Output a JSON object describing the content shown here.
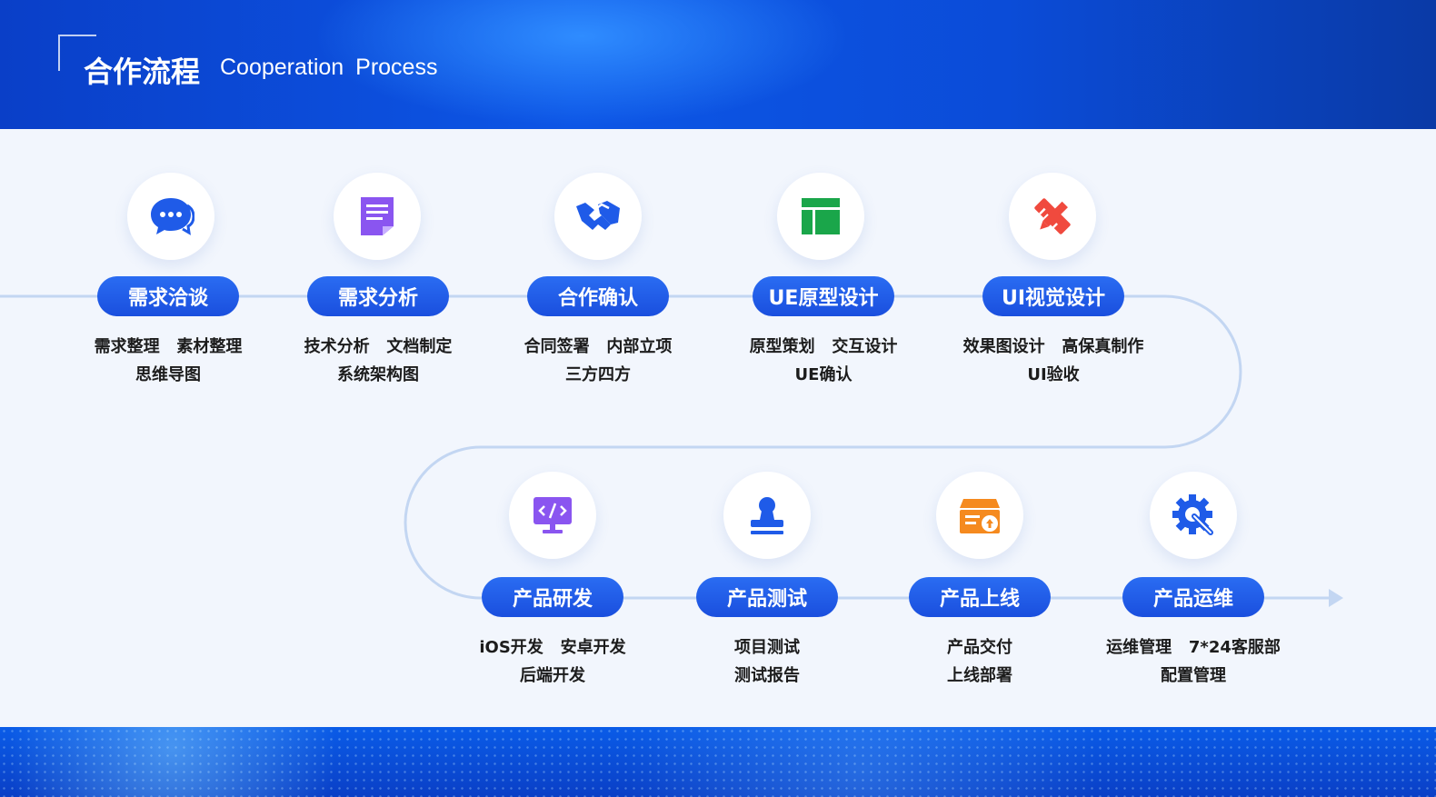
{
  "header": {
    "title_cn": "合作流程",
    "title_en": "Cooperation  Process"
  },
  "colors": {
    "header_blue": "#0d56e6",
    "pill_blue": "#1f5be8",
    "flow_line": "#c3d6f2",
    "background": "#f2f6fd"
  },
  "steps": [
    {
      "label": "需求洽谈",
      "icon": "chat-bubbles-icon",
      "line1": "需求整理   素材整理",
      "line2": "思维导图"
    },
    {
      "label": "需求分析",
      "icon": "document-list-icon",
      "line1": "技术分析   文档制定",
      "line2": "系统架构图"
    },
    {
      "label": "合作确认",
      "icon": "handshake-icon",
      "line1": "合同签署   内部立项",
      "line2": "三方四方"
    },
    {
      "label": "UE原型设计",
      "icon": "layout-grid-icon",
      "line1": "原型策划   交互设计",
      "line2": "UE确认"
    },
    {
      "label": "UI视觉设计",
      "icon": "pencil-ruler-icon",
      "line1": "效果图设计   高保真制作",
      "line2": "UI验收"
    },
    {
      "label": "产品研发",
      "icon": "code-monitor-icon",
      "line1": "iOS开发   安卓开发",
      "line2": "后端开发"
    },
    {
      "label": "产品测试",
      "icon": "stamp-icon",
      "line1": "项目测试",
      "line2": "测试报告"
    },
    {
      "label": "产品上线",
      "icon": "upload-box-icon",
      "line1": "产品交付",
      "line2": "上线部署"
    },
    {
      "label": "产品运维",
      "icon": "gear-wrench-icon",
      "line1": "运维管理   7*24客服部",
      "line2": "配置管理"
    }
  ]
}
